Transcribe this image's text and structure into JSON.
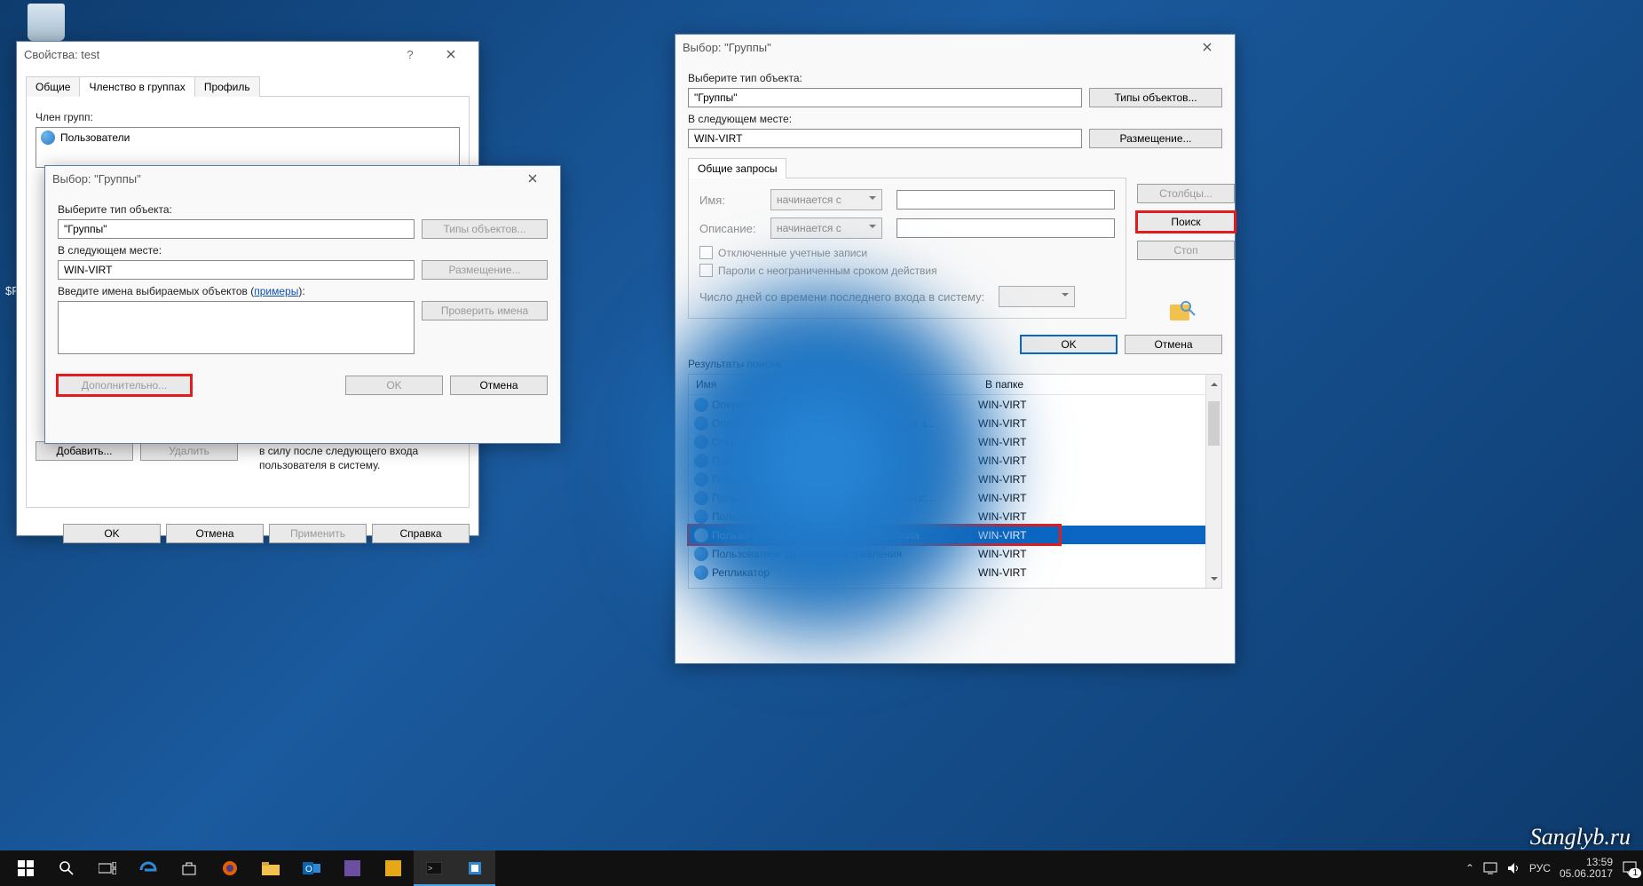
{
  "desktop": {
    "recycle_label": "$F"
  },
  "win1": {
    "title": "Свойства: test",
    "tabs": {
      "general": "Общие",
      "membership": "Членство в группах",
      "profile": "Профиль"
    },
    "memberof_label": "Член групп:",
    "group_item": "Пользователи",
    "note": "Изменения членства в группах вступят в силу после следующего входа пользователя в систему.",
    "add": "Добавить...",
    "remove": "Удалить",
    "ok": "OK",
    "cancel": "Отмена",
    "apply": "Применить",
    "help": "Справка"
  },
  "win2": {
    "title": "Выбор: \"Группы\"",
    "type_label": "Выберите тип объекта:",
    "type_val": "\"Группы\"",
    "type_btn": "Типы объектов...",
    "loc_label": "В следующем месте:",
    "loc_val": "WIN-VIRT",
    "loc_btn": "Размещение...",
    "names_label_pre": "Введите имена выбираемых объектов (",
    "names_label_link": "примеры",
    "names_label_post": "):",
    "check_names": "Проверить имена",
    "advanced": "Дополнительно...",
    "ok": "OK",
    "cancel": "Отмена"
  },
  "win3": {
    "title": "Выбор: \"Группы\"",
    "type_label": "Выберите тип объекта:",
    "type_val": "\"Группы\"",
    "type_btn": "Типы объектов...",
    "loc_label": "В следующем месте:",
    "loc_val": "WIN-VIRT",
    "loc_btn": "Размещение...",
    "common_tab": "Общие запросы",
    "name_label": "Имя:",
    "desc_label": "Описание:",
    "starts": "начинается с",
    "disabled_accounts": "Отключенные учетные записи",
    "nonexp": "Пароли с неограниченным сроком действия",
    "lastlogon": "Число дней со времени последнего входа в систему:",
    "columns": "Столбцы...",
    "find": "Поиск",
    "stop": "Стоп",
    "ok": "OK",
    "cancel": "Отмена",
    "results_label": "Результаты поиска:",
    "col_name": "Имя",
    "col_folder": "В папке",
    "rows": [
      {
        "n": "Операторы настройки сети",
        "f": "WIN-VIRT"
      },
      {
        "n": "Операторы помощи по контролю учетных з...",
        "f": "WIN-VIRT"
      },
      {
        "n": "Опытные пользователи",
        "f": "WIN-VIRT"
      },
      {
        "n": "Пользователи",
        "f": "WIN-VIRT"
      },
      {
        "n": "Пользователи DCOM",
        "f": "WIN-VIRT"
      },
      {
        "n": "Пользователи журналов производительнос...",
        "f": "WIN-VIRT"
      },
      {
        "n": "Пользователи системного монитора",
        "f": "WIN-VIRT"
      },
      {
        "n": "Пользователи удаленного рабочего стола",
        "f": "WIN-VIRT",
        "sel": true
      },
      {
        "n": "Пользователи удаленного управления",
        "f": "WIN-VIRT"
      },
      {
        "n": "Репликатор",
        "f": "WIN-VIRT"
      }
    ]
  },
  "tray": {
    "lang": "РУС",
    "time": "13:59",
    "date": "05.06.2017",
    "notif": "1"
  },
  "watermark": "Sanglyb.ru"
}
